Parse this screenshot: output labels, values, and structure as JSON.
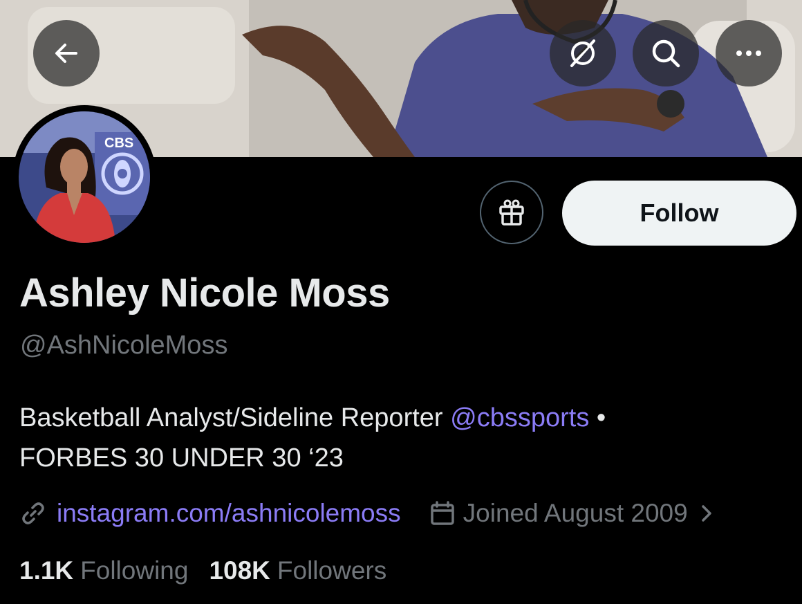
{
  "header": {
    "back_icon": "arrow-left-icon",
    "grok_icon": "grok-icon",
    "search_icon": "search-icon",
    "more_icon": "more-horizontal-icon"
  },
  "avatar": {
    "logo_text": "CBS"
  },
  "actions": {
    "gift_icon": "gift-icon",
    "follow_label": "Follow"
  },
  "profile": {
    "display_name": "Ashley Nicole Moss",
    "handle": "@AshNicoleMoss",
    "bio_line1_text": "Basketball Analyst/Sideline Reporter ",
    "bio_mention": "@cbssports",
    "bio_line1_suffix": " •",
    "bio_line2": "FORBES 30 UNDER 30 ‘23",
    "website": "instagram.com/ashnicolemoss",
    "joined": "Joined August 2009"
  },
  "stats": {
    "following_count": "1.1K",
    "following_label": "Following",
    "followers_count": "108K",
    "followers_label": "Followers"
  },
  "colors": {
    "background": "#000000",
    "link": "#8b7cf6",
    "secondary_text": "#71767b",
    "follow_button": "#eff3f4"
  }
}
